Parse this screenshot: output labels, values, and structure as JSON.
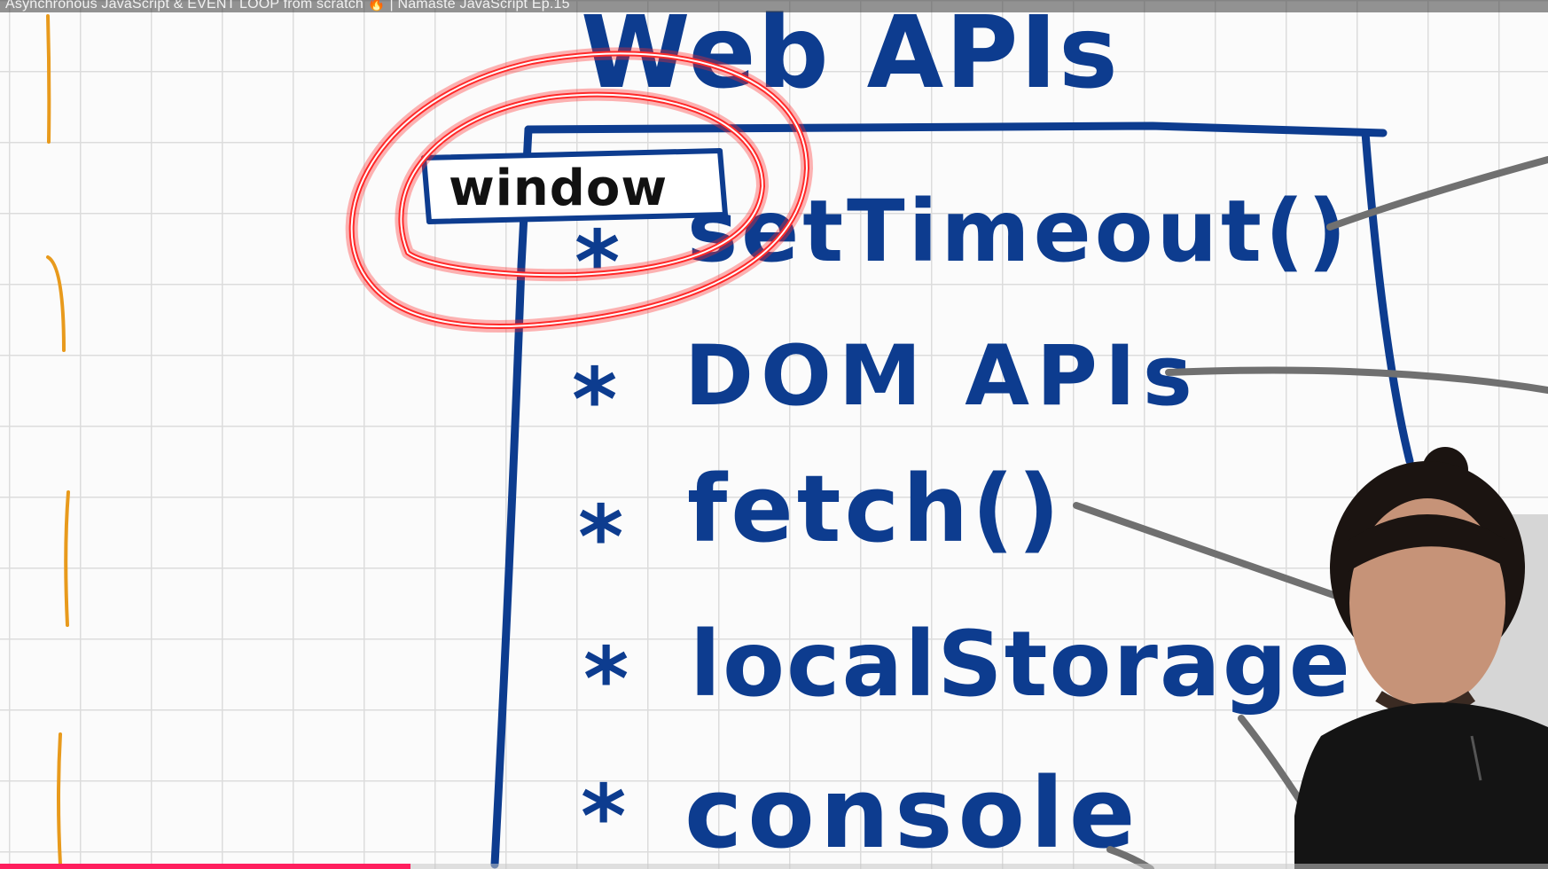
{
  "video": {
    "title": "Asynchronous JavaScript & EVENT LOOP from scratch 🔥 | Namaste JavaScript Ep.15",
    "progress_fraction": 0.265
  },
  "whiteboard": {
    "heading": "Web APIs",
    "window_label": "window",
    "items": [
      {
        "bullet": "*",
        "text": "setTimeout()"
      },
      {
        "bullet": "*",
        "text": "DOM APIs"
      },
      {
        "bullet": "*",
        "text": "fetch()"
      },
      {
        "bullet": "*",
        "text": "localStorage"
      },
      {
        "bullet": "*",
        "text": "console"
      }
    ]
  },
  "colors": {
    "ink_blue": "#0d3c8f",
    "highlight_red": "#ff2a2a",
    "margin_orange": "#e89a1c",
    "connector_gray": "#707070",
    "progress": "#ff1f5e"
  }
}
